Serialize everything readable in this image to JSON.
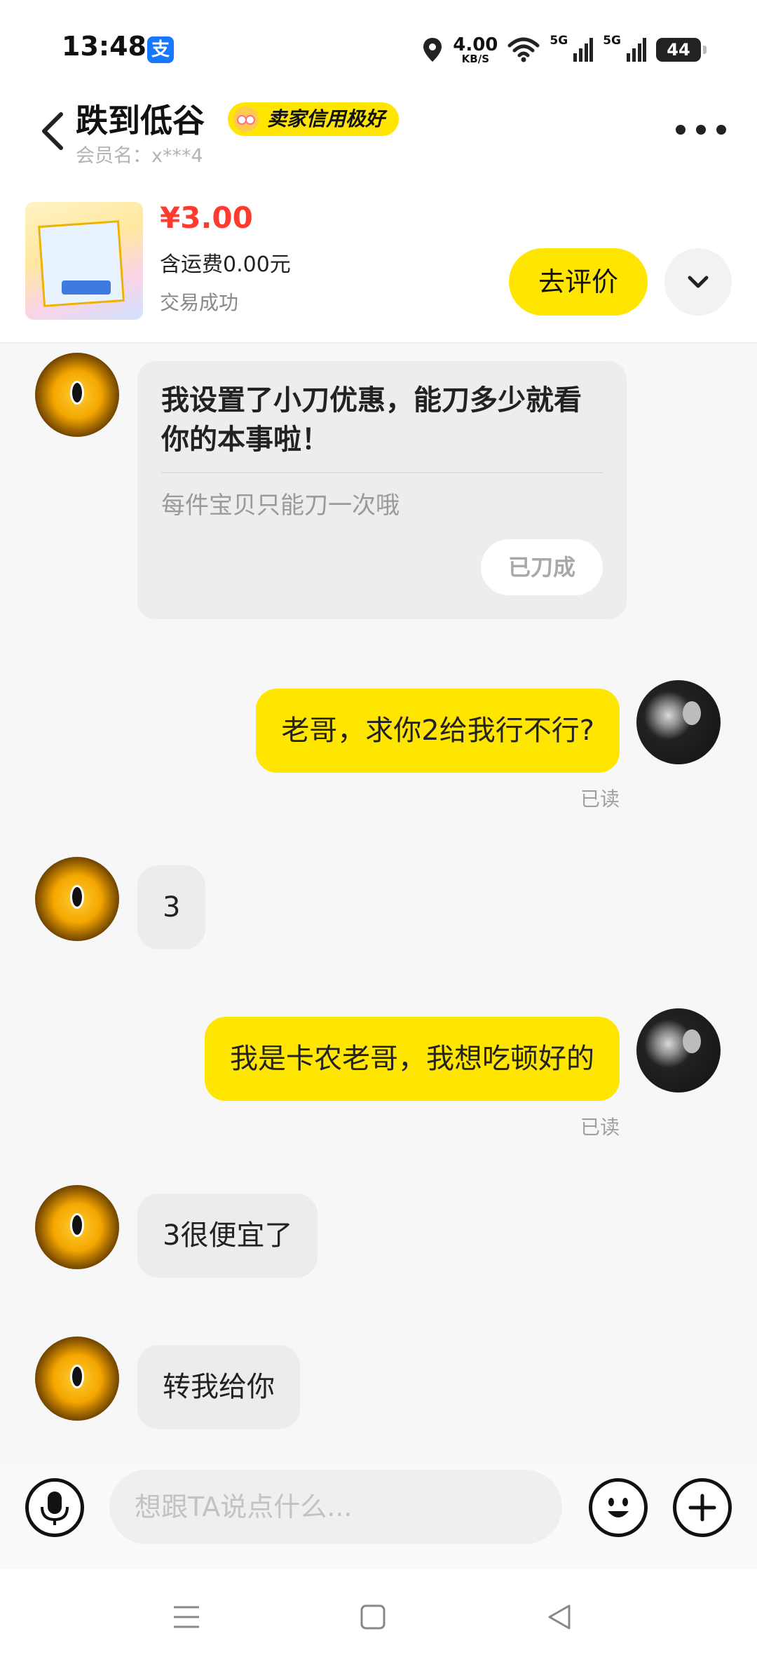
{
  "status_bar": {
    "time": "13:48",
    "alipay_glyph": "支",
    "net_speed_value": "4.00",
    "net_speed_unit": "KB/S",
    "network_1": "5G",
    "network_2": "5G",
    "battery": "44",
    "icons": [
      "location-icon",
      "wifi-icon",
      "signal-icon",
      "battery-icon"
    ]
  },
  "header": {
    "seller_name": "跌到低谷",
    "credit_badge": "卖家信用极好",
    "member_name": "会员名：x***4"
  },
  "product": {
    "price": "¥3.00",
    "shipping": "含运费0.00元",
    "status": "交易成功",
    "review_button": "去评价"
  },
  "messages": [
    {
      "type": "card",
      "from": "seller",
      "title": "我设置了小刀优惠，能刀多少就看你的本事啦！",
      "subtitle": "每件宝贝只能刀一次哦",
      "button": "已刀成"
    },
    {
      "type": "text",
      "from": "me",
      "text": "老哥，求你2给我行不行?",
      "read": "已读"
    },
    {
      "type": "text",
      "from": "seller",
      "text": "3"
    },
    {
      "type": "text",
      "from": "me",
      "text": "我是卡农老哥，我想吃顿好的",
      "read": "已读"
    },
    {
      "type": "text",
      "from": "seller",
      "text": "3很便宜了"
    },
    {
      "type": "text",
      "from": "seller",
      "text": "转我给你"
    }
  ],
  "input_bar": {
    "placeholder": "想跟TA说点什么..."
  },
  "colors": {
    "accent_yellow": "#ffe600",
    "price_red": "#ff3b30",
    "bubble_gray": "#ececec"
  }
}
